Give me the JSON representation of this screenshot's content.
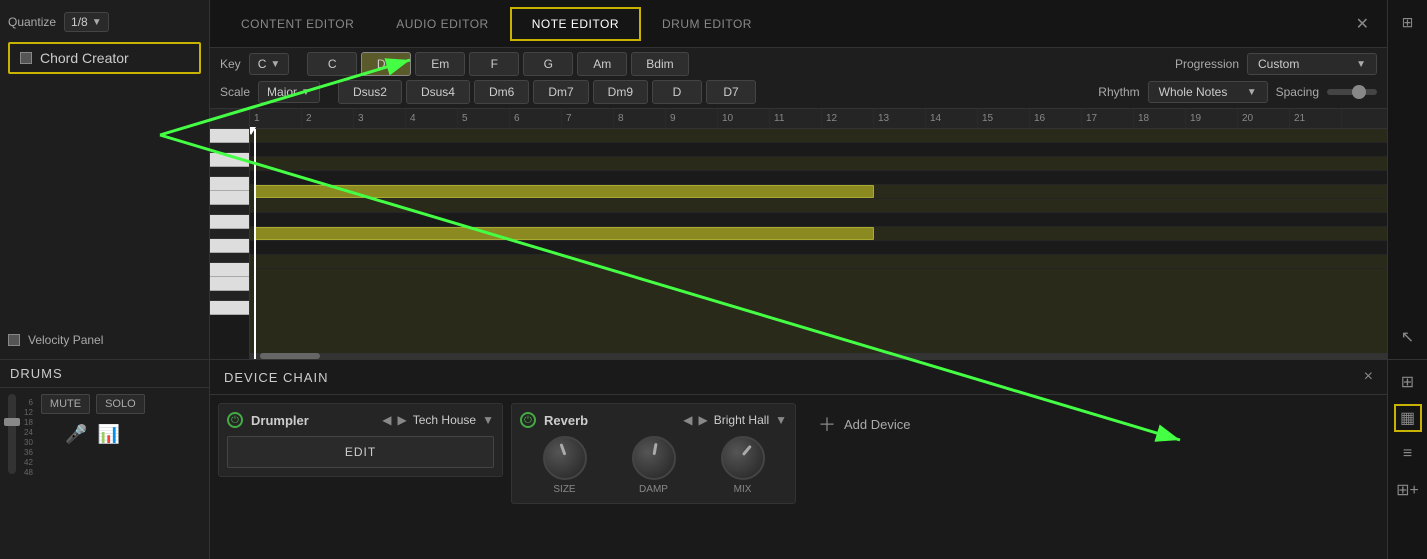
{
  "tabs": {
    "content_editor": "CONTENT EDITOR",
    "audio_editor": "AUDIO EDITOR",
    "note_editor": "NOTE EDITOR",
    "drum_editor": "DRUM EDITOR"
  },
  "quantize": {
    "label": "Quantize",
    "value": "1/8"
  },
  "chord_creator": {
    "label": "Chord Creator"
  },
  "velocity_panel": {
    "label": "Velocity Panel"
  },
  "key": {
    "label": "Key",
    "value": "C"
  },
  "chords_row1": [
    "C",
    "Dm",
    "Em",
    "F",
    "G",
    "Am",
    "Bdim"
  ],
  "chords_row2": [
    "Dsus2",
    "Dsus4",
    "Dm6",
    "Dm7",
    "Dm9",
    "D",
    "D7"
  ],
  "progression": {
    "label": "Progression",
    "value": "Custom"
  },
  "scale": {
    "label": "Scale",
    "value": "Major"
  },
  "rhythm": {
    "label": "Rhythm",
    "value": "Whole Notes"
  },
  "spacing": {
    "label": "Spacing"
  },
  "grid_numbers": [
    "1",
    "2",
    "3",
    "4",
    "5",
    "6",
    "7",
    "8",
    "9",
    "10",
    "11",
    "12",
    "13",
    "14",
    "15",
    "16",
    "17",
    "18",
    "19",
    "20",
    "21"
  ],
  "drums": {
    "title": "DRUMS",
    "mute": "MUTE",
    "solo": "SOLO"
  },
  "device_chain": {
    "title": "DEVICE CHAIN",
    "close": "×"
  },
  "drumpler": {
    "power_active": true,
    "name": "Drumpler",
    "preset": "Tech House",
    "edit_label": "EDIT"
  },
  "reverb": {
    "power_active": true,
    "name": "Reverb",
    "preset": "Bright Hall",
    "knobs": {
      "size_label": "SIZE",
      "damp_label": "DAMP",
      "mix_label": "MIX"
    }
  },
  "add_device": {
    "label": "Add Device"
  },
  "level_labels": [
    "6",
    "12",
    "18",
    "24",
    "30",
    "36",
    "42",
    "48"
  ]
}
